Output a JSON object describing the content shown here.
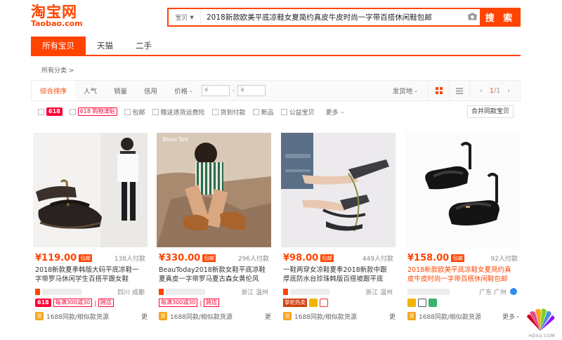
{
  "header": {
    "logo_cn": "淘宝网",
    "logo_en": "Taobao.com",
    "search_category": "宝贝",
    "search_query": "2018新款欧美平底凉鞋女夏简约真皮牛皮时尚一字带百搭休闲鞋包邮",
    "search_button": "搜 索"
  },
  "tabs": [
    {
      "label": "所有宝贝"
    },
    {
      "label": "天猫"
    },
    {
      "label": "二手"
    }
  ],
  "breadcrumb": "所有分类 >",
  "filter_bar": {
    "sorts": [
      "综合排序",
      "人气",
      "销量",
      "信用",
      "价格"
    ],
    "price_min_placeholder": "¥",
    "price_max_placeholder": "¥",
    "ship_from": "发货地",
    "page_current": "1",
    "page_total": "/1"
  },
  "options": {
    "tag_618": "618",
    "tag_618_subsidy": "618 购物津贴",
    "items": [
      "包邮",
      "赠送退货运费险",
      "货到付款",
      "新品",
      "公益宝贝"
    ],
    "more": "更多",
    "merge": "合并同款宝贝"
  },
  "products": [
    {
      "price": "¥119.00",
      "free_ship": "包邮",
      "sold": "138人付款",
      "title": "2018新款夏季韩版大码平底凉鞋一字带罗马休闲学生百搭平跟女鞋",
      "location": "四川 成都",
      "promo_tag": "618",
      "promo_text": "每满300减30",
      "promo_extra": "跨店",
      "similar": "1688同款/相似款货源",
      "similar_more": "更"
    },
    {
      "price": "¥330.00",
      "free_ship": "包邮",
      "sold": "296人付款",
      "title": "BeauToday2018新款女鞋平底凉鞋夏真皮一字带罗马夏古森女黄伦风",
      "location": "浙江 温州",
      "promo_text": "每满300减30",
      "promo_extra": "跨店",
      "similar": "1688同款/相似款货源",
      "similar_more": "更"
    },
    {
      "price": "¥98.00",
      "free_ship": "包邮",
      "sold": "449人付款",
      "title": "一鞋两穿女凉鞋夏季2018新款中跟厚底防水台珍珠韩版百搭坡跟平底",
      "location": "浙江 温州",
      "badge_text": "掌柜热卖",
      "similar": "1688同款/相似款货源",
      "similar_more": "更"
    },
    {
      "price": "¥158.00",
      "free_ship": "包邮",
      "sold": "92人付款",
      "title": "2018新款欧美平底凉鞋女夏简约真皮牛皮时尚一字带百搭休闲鞋包邮",
      "location": "广东 广州",
      "similar": "1688同款/相似款货源",
      "similar_more": "更多"
    }
  ],
  "colors": {
    "accent": "#ff4400",
    "tmall_red": "#ff0036"
  },
  "watermark": "HDSU.COM"
}
